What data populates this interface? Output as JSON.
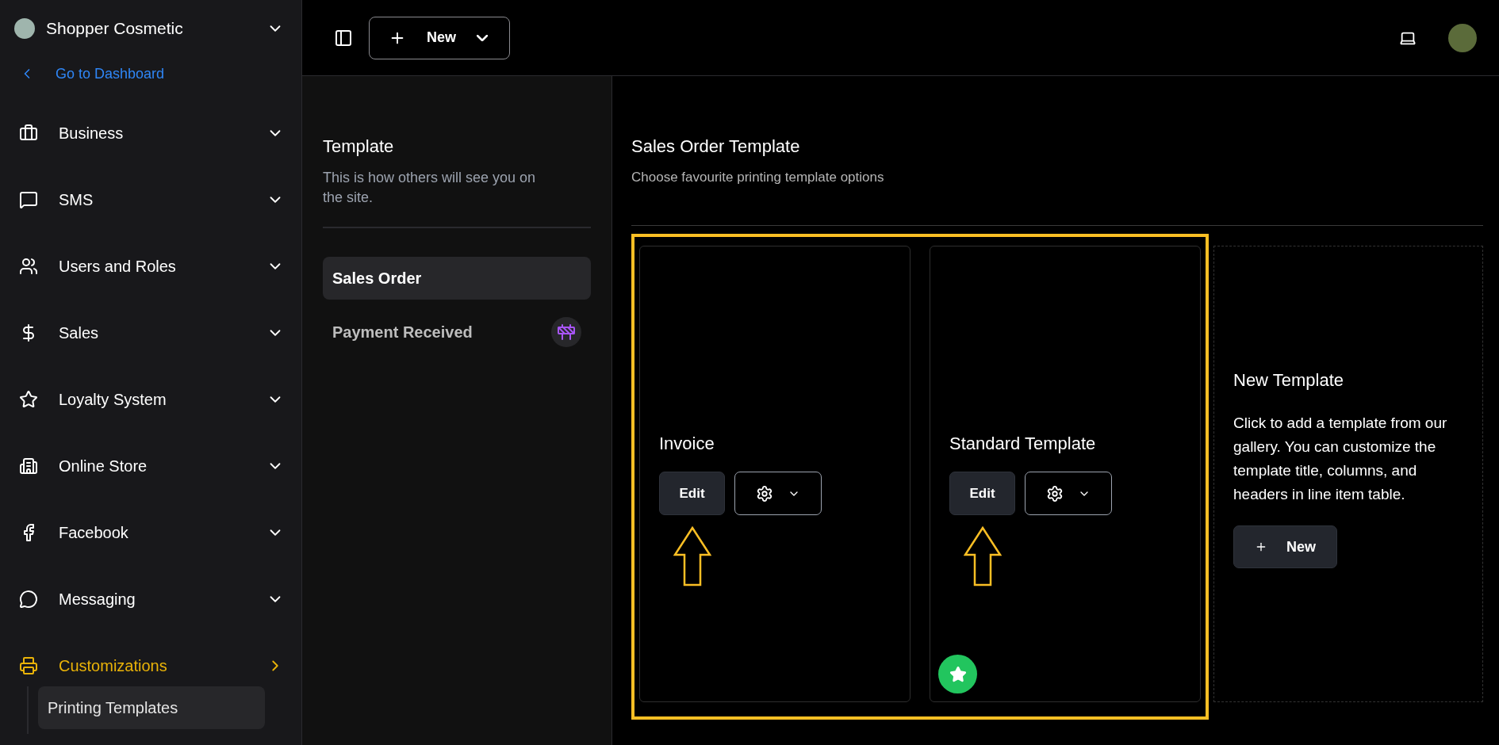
{
  "org": {
    "name": "Shopper Cosmetic"
  },
  "back_link": {
    "label": "Go to Dashboard"
  },
  "nav": [
    {
      "label": "Business",
      "selected": false
    },
    {
      "label": "SMS",
      "selected": false
    },
    {
      "label": "Users and Roles",
      "selected": false
    },
    {
      "label": "Sales",
      "selected": false
    },
    {
      "label": "Loyalty System",
      "selected": false
    },
    {
      "label": "Online Store",
      "selected": false
    },
    {
      "label": "Facebook",
      "selected": false
    },
    {
      "label": "Messaging",
      "selected": false
    },
    {
      "label": "Customizations",
      "selected": true,
      "children": [
        {
          "label": "Printing Templates",
          "selected": true
        }
      ]
    }
  ],
  "toolbar": {
    "new_button": "New"
  },
  "template_panel": {
    "title": "Template",
    "description": "This is how others will see you on the site.",
    "items": [
      {
        "label": "Sales Order",
        "selected": true,
        "in_progress": false
      },
      {
        "label": "Payment Received",
        "selected": false,
        "in_progress": true
      }
    ]
  },
  "content": {
    "title": "Sales Order Template",
    "subtitle": "Choose favourite printing template options",
    "templates": [
      {
        "name": "Invoice",
        "edit_label": "Edit",
        "default": false,
        "annotated": true
      },
      {
        "name": "Standard Template",
        "edit_label": "Edit",
        "default": true,
        "annotated": true
      }
    ],
    "new_card": {
      "title": "New Template",
      "description": "Click to add a template from our gallery. You can customize the template title, columns, and headers in line item table.",
      "button": "New"
    }
  }
}
